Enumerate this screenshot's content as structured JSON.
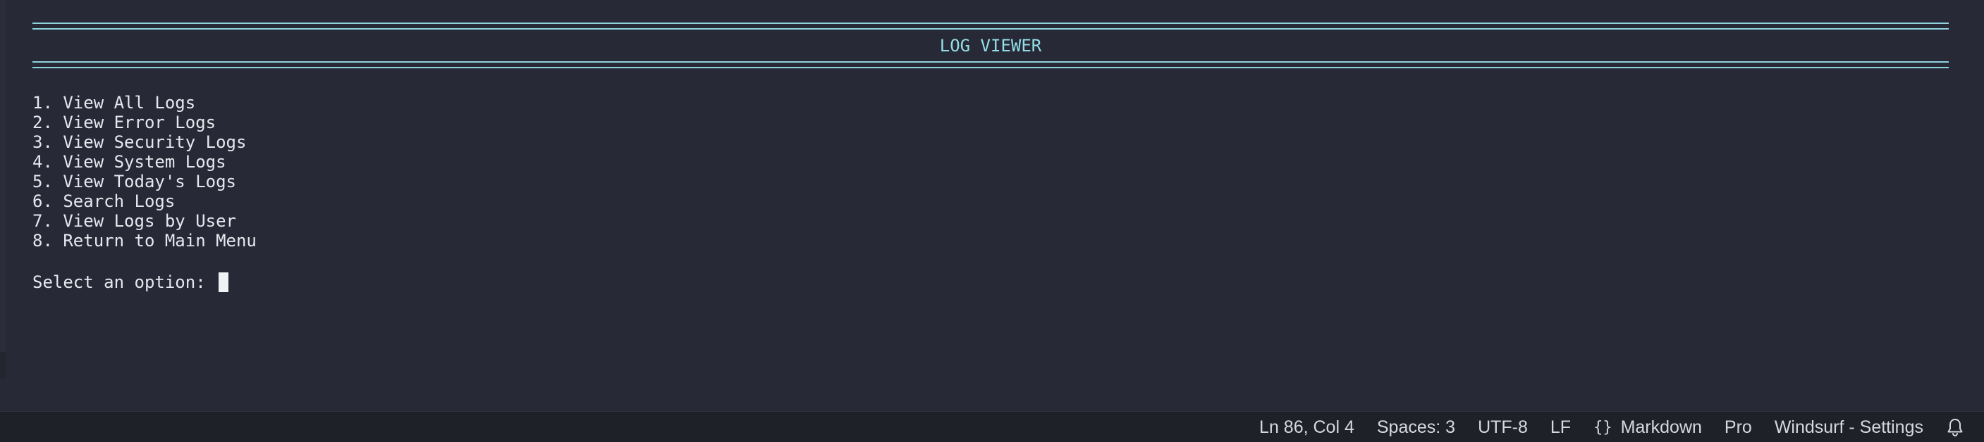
{
  "terminal": {
    "title": "LOG VIEWER",
    "menu_items": [
      "1. View All Logs",
      "2. View Error Logs",
      "3. View Security Logs",
      "4. View System Logs",
      "5. View Today's Logs",
      "6. Search Logs",
      "7. View Logs by User",
      "8. Return to Main Menu"
    ],
    "prompt": "Select an option: "
  },
  "statusbar": {
    "position": "Ln 86, Col 4",
    "indentation": "Spaces: 3",
    "encoding": "UTF-8",
    "line_ending": "LF",
    "language_icon": "braces-icon",
    "language": "Markdown",
    "plan": "Pro",
    "settings": "Windsurf - Settings",
    "notifications_icon": "bell-icon"
  },
  "colors": {
    "background": "#272a36",
    "rule": "#8fd3df",
    "title": "#93dfe9",
    "text": "#e6e8ef",
    "statusbar_bg": "#1f2129"
  }
}
